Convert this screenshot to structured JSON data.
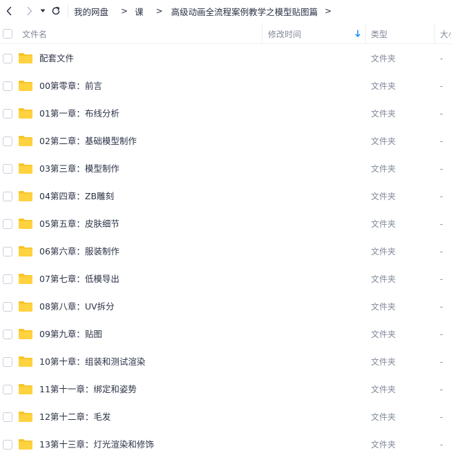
{
  "breadcrumb": {
    "items": [
      "我的网盘",
      "课",
      "高级动画全流程案例教学之模型贴图篇"
    ],
    "separator": ">"
  },
  "table": {
    "headers": {
      "name": "文件名",
      "modified": "修改时间",
      "type": "类型",
      "size": "大小"
    },
    "sort_column": "modified",
    "rows": [
      {
        "name": "配套文件",
        "type": "文件夹",
        "size": "-"
      },
      {
        "name": "00第零章：前言",
        "type": "文件夹",
        "size": "-"
      },
      {
        "name": "01第一章：布线分析",
        "type": "文件夹",
        "size": "-"
      },
      {
        "name": "02第二章：基础模型制作",
        "type": "文件夹",
        "size": "-"
      },
      {
        "name": "03第三章：模型制作",
        "type": "文件夹",
        "size": "-"
      },
      {
        "name": "04第四章：ZB雕刻",
        "type": "文件夹",
        "size": "-"
      },
      {
        "name": "05第五章：皮肤细节",
        "type": "文件夹",
        "size": "-"
      },
      {
        "name": "06第六章：服装制作",
        "type": "文件夹",
        "size": "-"
      },
      {
        "name": "07第七章：低模导出",
        "type": "文件夹",
        "size": "-"
      },
      {
        "name": "08第八章：UV拆分",
        "type": "文件夹",
        "size": "-"
      },
      {
        "name": "09第九章：贴图",
        "type": "文件夹",
        "size": "-"
      },
      {
        "name": "10第十章：组装和测试渲染",
        "type": "文件夹",
        "size": "-"
      },
      {
        "name": "11第十一章：绑定和姿势",
        "type": "文件夹",
        "size": "-"
      },
      {
        "name": "12第十二章：毛发",
        "type": "文件夹",
        "size": "-"
      },
      {
        "name": "13第十三章：灯光渲染和修饰",
        "type": "文件夹",
        "size": "-"
      }
    ]
  },
  "colors": {
    "folder": "#ffd23f",
    "folder_tab": "#f7c325",
    "sort_arrow": "#1a8cff",
    "text_primary": "#2b3245",
    "text_secondary": "#818999"
  },
  "icons": {
    "back": "chevron-left-icon",
    "forward": "chevron-right-icon",
    "dropdown": "caret-down-icon",
    "refresh": "refresh-icon",
    "folder": "folder-icon",
    "sort": "arrow-down-icon"
  }
}
